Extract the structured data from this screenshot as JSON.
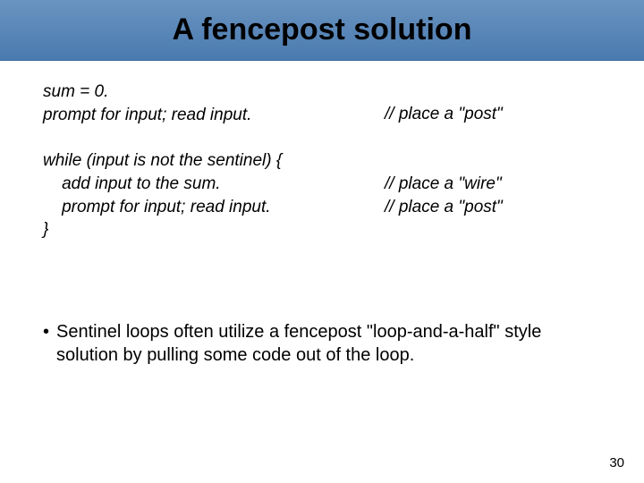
{
  "title": "A fencepost solution",
  "code": {
    "l1": "sum = 0.",
    "l2": "prompt for input; read input.",
    "c2": "// place a \"post\"",
    "blank": "",
    "l3": "while (input is not the sentinel) {",
    "l4": "    add input to the sum.",
    "c4": "// place a \"wire\"",
    "l5": "    prompt for input; read input.",
    "c5": "// place a \"post\"",
    "l6": "}"
  },
  "bullet": {
    "mark": "•",
    "text": "Sentinel loops often utilize a fencepost \"loop-and-a-half\" style solution by pulling some code out of the loop."
  },
  "page_number": "30"
}
